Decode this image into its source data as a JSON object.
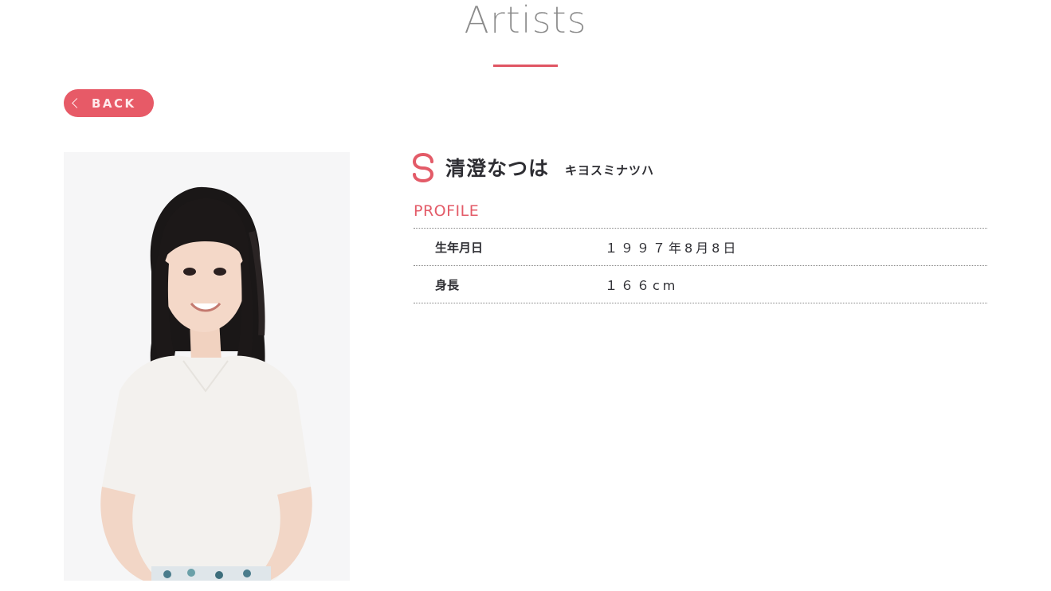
{
  "header": {
    "title": "Artists"
  },
  "nav": {
    "back_label": "BACK"
  },
  "artist": {
    "name": "清澄なつは",
    "kana": "キヨスミナツハ",
    "photo_alt": "清澄なつは"
  },
  "profile": {
    "heading": "PROFILE",
    "rows": [
      {
        "key": "生年月日",
        "value": "１９９７年8月8日"
      },
      {
        "key": "身長",
        "value": "１６６cm"
      }
    ]
  },
  "colors": {
    "accent": "#e35b68",
    "button": "#e75a67"
  },
  "icons": {
    "back": "chevron-left-icon",
    "brand": "brand-logo-icon"
  }
}
